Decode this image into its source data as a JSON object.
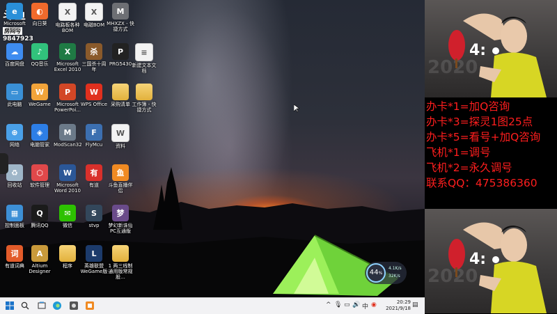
{
  "watermark": {
    "logo": "斗鱼",
    "sub": "房间号",
    "number": "9847923"
  },
  "desktop_icons": [
    {
      "label": "Microsoft Edge",
      "icon": "edge-icon",
      "color": "#2a8fd8",
      "glyph": "e"
    },
    {
      "label": "向日葵",
      "icon": "sunflower-icon",
      "color": "#f06a2c",
      "glyph": "◐"
    },
    {
      "label": "电路板各种BOM",
      "icon": "excel-file-icon",
      "color": "#21a366",
      "glyph": "X"
    },
    {
      "label": "电磁BOM",
      "icon": "excel-file-icon",
      "color": "#21a366",
      "glyph": "X"
    },
    {
      "label": "MHXZX - 快捷方式",
      "icon": "game-shortcut-icon",
      "color": "#6d6f74",
      "glyph": "M"
    },
    {
      "label": "百度网盘",
      "icon": "baidu-netdisk-icon",
      "color": "#3e8cf0",
      "glyph": "☁"
    },
    {
      "label": "QQ音乐",
      "icon": "qq-music-icon",
      "color": "#31c27c",
      "glyph": "♪"
    },
    {
      "label": "Microsoft Excel 2010",
      "icon": "excel-icon",
      "color": "#1f7a44",
      "glyph": "X"
    },
    {
      "label": "三国杀十周年",
      "icon": "sanguosha-icon",
      "color": "#8a5a2b",
      "glyph": "杀"
    },
    {
      "label": "PRG5430",
      "icon": "prg-icon",
      "color": "#222222",
      "glyph": "P"
    },
    {
      "label": "新建文本文档",
      "icon": "text-file-icon",
      "color": "#f3f3f3",
      "glyph": "≡"
    },
    {
      "label": "此电脑",
      "icon": "this-pc-icon",
      "color": "#3a90d6",
      "glyph": "▭"
    },
    {
      "label": "WeGame",
      "icon": "wegame-icon",
      "color": "#f2a43a",
      "glyph": "W"
    },
    {
      "label": "Microsoft PowerPoi...",
      "icon": "powerpoint-icon",
      "color": "#d24726",
      "glyph": "P"
    },
    {
      "label": "WPS Office",
      "icon": "wps-icon",
      "color": "#e0301e",
      "glyph": "W"
    },
    {
      "label": "采购清单",
      "icon": "folder-icon",
      "color": "#e8b94a",
      "glyph": ""
    },
    {
      "label": "工作簿 - 快捷方式",
      "icon": "folder-shortcut-icon",
      "color": "#e8b94a",
      "glyph": ""
    },
    {
      "label": "网络",
      "icon": "network-icon",
      "color": "#4aa0e8",
      "glyph": "⊕"
    },
    {
      "label": "电脑管家",
      "icon": "pc-manager-icon",
      "color": "#2d7ee6",
      "glyph": "◈"
    },
    {
      "label": "ModScan32",
      "icon": "modscan-icon",
      "color": "#6c7a89",
      "glyph": "M"
    },
    {
      "label": "FlyMcu",
      "icon": "flymcu-icon",
      "color": "#3c6fb0",
      "glyph": "F"
    },
    {
      "label": "资料",
      "icon": "word-file-icon",
      "color": "#f3f3f3",
      "glyph": "W"
    },
    {
      "label": "回收站",
      "icon": "recycle-bin-icon",
      "color": "#9fb6c8",
      "glyph": "♻"
    },
    {
      "label": "软件管理",
      "icon": "software-manager-icon",
      "color": "#e0484a",
      "glyph": "⬡"
    },
    {
      "label": "Microsoft Word 2010",
      "icon": "word-icon",
      "color": "#2b5797",
      "glyph": "W"
    },
    {
      "label": "有道",
      "icon": "youdao-icon",
      "color": "#d9302b",
      "glyph": "有"
    },
    {
      "label": "斗鱼直播伴侣",
      "icon": "douyu-companion-icon",
      "color": "#f08a22",
      "glyph": "鱼"
    },
    {
      "label": "控制面板",
      "icon": "control-panel-icon",
      "color": "#3d8fd6",
      "glyph": "▦"
    },
    {
      "label": "腾讯QQ",
      "icon": "qq-icon",
      "color": "#1b1b1b",
      "glyph": "Q"
    },
    {
      "label": "微信",
      "icon": "wechat-icon",
      "color": "#2dc100",
      "glyph": "✉"
    },
    {
      "label": "stvp",
      "icon": "stvp-icon",
      "color": "#33475b",
      "glyph": "S"
    },
    {
      "label": "梦幻新诛仙PC互通版",
      "icon": "game-icon",
      "color": "#6a4b8a",
      "glyph": "梦"
    },
    {
      "label": "有道词典",
      "icon": "youdao-dict-icon",
      "color": "#e25b2a",
      "glyph": "词"
    },
    {
      "label": "Altium Designer",
      "icon": "altium-icon",
      "color": "#c99a3b",
      "glyph": "A"
    },
    {
      "label": "程序",
      "icon": "folder-icon",
      "color": "#e8b94a",
      "glyph": ""
    },
    {
      "label": "英雄联盟WeGame版",
      "icon": "lol-icon",
      "color": "#1c3b6b",
      "glyph": "L"
    },
    {
      "label": "1 两三线制通用版常规股...",
      "icon": "folder-icon",
      "color": "#e8b94a",
      "glyph": ""
    }
  ],
  "speed_widget": {
    "percent": "44",
    "percent_unit": "%",
    "up": "4.1K/s",
    "down": "32K/s"
  },
  "taskbar": {
    "icons": [
      "start-icon",
      "search-icon",
      "task-view-icon",
      "edge-icon",
      "game-icon",
      "app-icon"
    ],
    "tray": {
      "ime": "中",
      "time": "20:29",
      "date": "2021/9/18"
    }
  },
  "panel": {
    "photo_text": "2020",
    "score": "4:",
    "promo_lines": [
      "办卡*1=加Q咨询",
      "办卡*3=探灵1图25点",
      "办卡*5=看号+加Q咨询",
      "飞机*1=调号",
      "飞机*2=永久调号",
      "联系QQ：475386360"
    ]
  },
  "colors": {
    "promo": "#ff1e1e",
    "taskbar": "#f2f2f4",
    "tent": "#7cdc3a"
  }
}
